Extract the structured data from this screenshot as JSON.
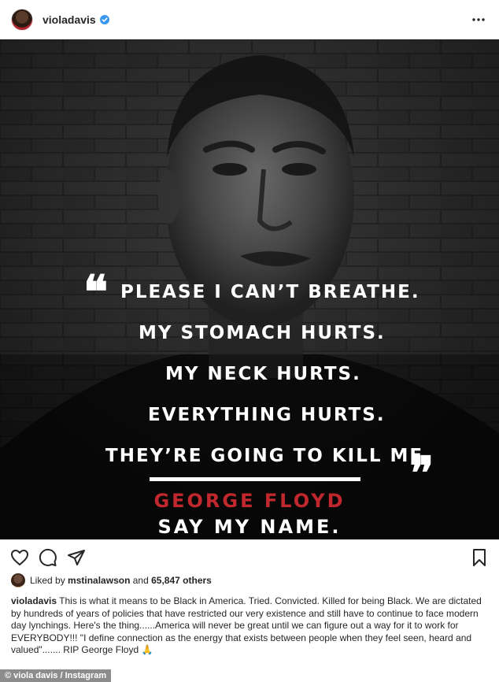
{
  "post": {
    "username": "violadavis",
    "verified": true,
    "more_icon": "more-horizontal-icon"
  },
  "image": {
    "quote_lines": [
      "PLEASE I CAN’T BREATHE.",
      "MY STOMACH HURTS.",
      "MY NECK HURTS.",
      "EVERYTHING HURTS.",
      "THEY’RE GOING TO KILL ME."
    ],
    "open_quote": "❝",
    "close_quote": "❞",
    "name": "GEORGE FLOYD",
    "tagline": "SAY MY NAME.",
    "name_color": "#c0282e"
  },
  "actions": {
    "like_icon": "heart-icon",
    "comment_icon": "comment-icon",
    "share_icon": "share-icon",
    "save_icon": "bookmark-icon"
  },
  "likes": {
    "prefix": "Liked by",
    "user": "mstinalawson",
    "middle": "and",
    "count": "65,847 others"
  },
  "caption": {
    "username": "violadavis",
    "text": "This is what it means to be Black in America. Tried. Convicted. Killed for being Black. We are dictated by hundreds of years of policies that have restricted our very existence and still have to continue to face modern day lynchings. Here's the thing......America will never be great until we can figure out a way for it to work for EVERYBODY!!! \"I define connection as the energy that exists between people when they feel seen, heard and valued\"....... RIP George Floyd 🙏"
  },
  "credit": "© viola davis / Instagram"
}
